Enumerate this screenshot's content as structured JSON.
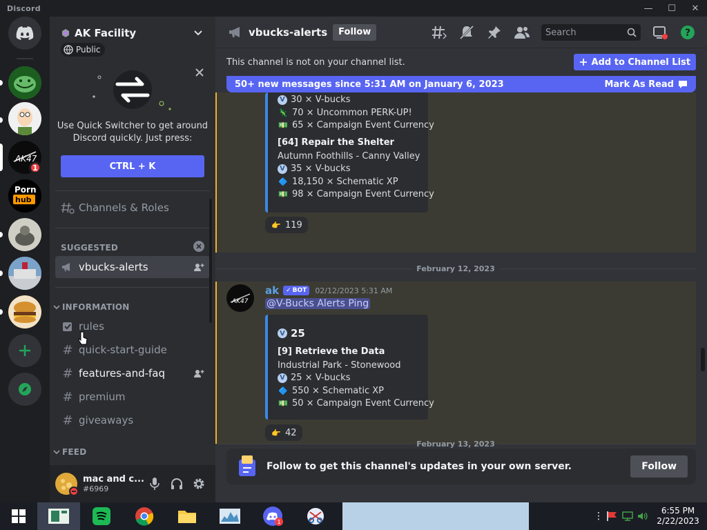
{
  "app": {
    "title": "Discord"
  },
  "server": {
    "name": "AK Facility",
    "visibility": "Public"
  },
  "quick_switcher": {
    "description": "Use Quick Switcher to get around Discord quickly. Just press:",
    "shortcut": "CTRL + K"
  },
  "sidebar": {
    "channels_roles": "Channels & Roles",
    "suggested_label": "SUGGESTED",
    "suggested_channel": "vbucks-alerts",
    "information_label": "INFORMATION",
    "channels": [
      {
        "name": "rules"
      },
      {
        "name": "quick-start-guide"
      },
      {
        "name": "features-and-faq"
      },
      {
        "name": "premium"
      },
      {
        "name": "giveaways"
      }
    ],
    "feed_label": "FEED"
  },
  "user": {
    "name": "mac and c...",
    "tag": "#6969"
  },
  "guild_badge": "1",
  "channel": {
    "name": "vbucks-alerts",
    "follow_label": "Follow",
    "search_placeholder": "Search",
    "notice": "This channel is not on your channel list.",
    "add_button": "Add to Channel List",
    "new_messages": "50+ new messages since 5:31 AM on January 6, 2023",
    "mark_read": "Mark As Read"
  },
  "messages": {
    "first_embed": {
      "lines": [
        "30 × V-bucks",
        "70 × Uncommon PERK-UP!",
        "65 × Campaign Event Currency"
      ],
      "mission_title": "[64] Repair the Shelter",
      "mission_location": "Autumn Foothills - Canny Valley",
      "rewards": [
        "35 × V-bucks",
        "18,150 × Schematic XP",
        "98 × Campaign Event Currency"
      ],
      "reaction_count": "119"
    },
    "date1": "February 12, 2023",
    "second": {
      "author": "ak",
      "bot_tag": "BOT",
      "timestamp": "02/12/2023 5:31 AM",
      "mention": "@V-Bucks Alerts Ping",
      "total": "25",
      "mission_title": "[9] Retrieve the Data",
      "mission_location": "Industrial Park - Stonewood",
      "rewards": [
        "25 × V-bucks",
        "550 × Schematic XP",
        "50 × Campaign Event Currency"
      ],
      "reaction_count": "42"
    },
    "date2": "February 13, 2023"
  },
  "follow_banner": {
    "text": "Follow to get this channel's updates in your own server.",
    "button": "Follow"
  },
  "taskbar": {
    "time": "6:55 PM",
    "date": "2/22/2023",
    "discord_badge": "1"
  }
}
